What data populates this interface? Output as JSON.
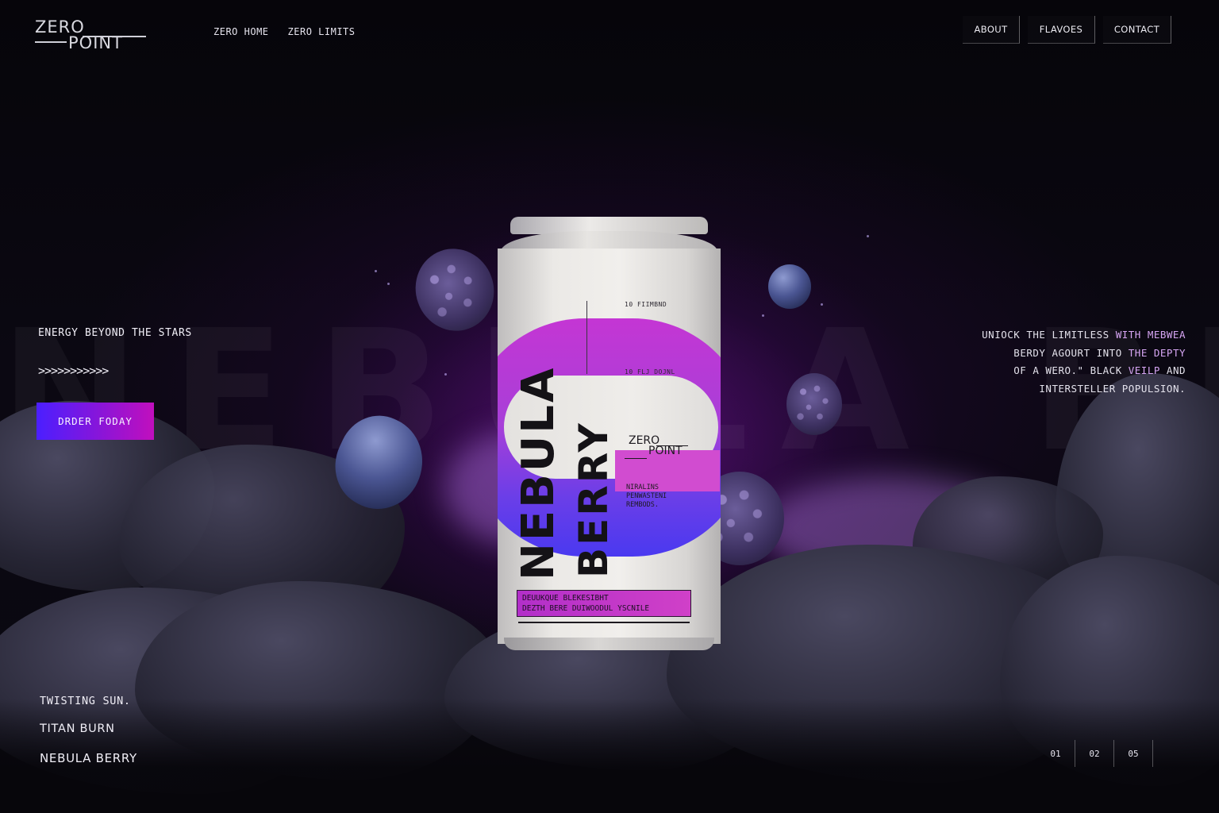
{
  "brand": {
    "logo_top": "ZERO",
    "logo_bottom": "POINT"
  },
  "nav_left": {
    "home": "ZERO HOME",
    "limits": "ZERO LIMITS"
  },
  "nav_right": {
    "about": "ABOUT",
    "flavors": "FLAVOES",
    "contact": "CONTACT"
  },
  "hero": {
    "tagline": "ENERGY BEYOND THE STARS",
    "chevrons": ">>>>>>>>>>>",
    "cta": "DRDER FODAY",
    "background_word": "NEBULA BERRY"
  },
  "description": {
    "line1_a": "UNIOCK THE LIMITLESS ",
    "line1_b": "WITH MEBWEA",
    "line2_a": "BERDY  AGOURT INTO ",
    "line2_b": "THE DEPTY",
    "line3_a": "OF A WERO.\" BLACK ",
    "line3_b": "VEILP",
    "line3_c": " AND",
    "line4": "INTERSTELLER POPULSION."
  },
  "can": {
    "name_line1": "NEBULA",
    "name_line2": "BERRY",
    "spec_top": "10 FIIMBND",
    "spec_mid": "10 FLJ DOJNL",
    "logo_top": "ZERO",
    "logo_bottom": "POINT",
    "block_line1": "NIRALINS",
    "block_line2": "PENWASTENI",
    "block_line3": "REMBODS.",
    "label_line1": "DEUUKQUE BLEKESIBHT",
    "label_line2": "DEZTH BERE DUIWOODUL YSCNILE"
  },
  "flavors": [
    {
      "label": "TWISTING SUN."
    },
    {
      "label": "TITAN BURN"
    },
    {
      "label": "NEBULA BERRY"
    }
  ],
  "pager": [
    "01",
    "02",
    "05"
  ],
  "colors": {
    "accent_start": "#4b1fff",
    "accent_end": "#c10fbd",
    "highlight": "#d7a6f4",
    "background": "#07060b"
  }
}
